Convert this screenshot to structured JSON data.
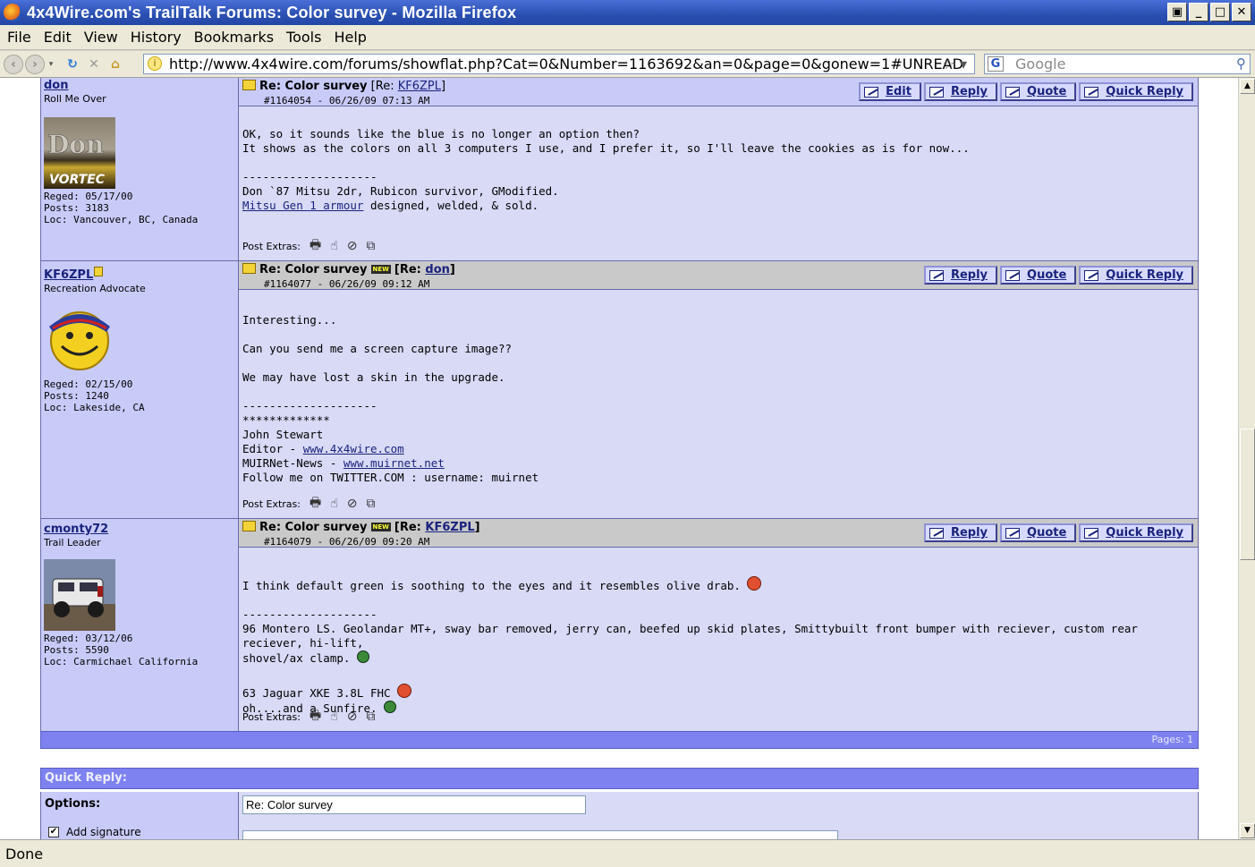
{
  "window": {
    "title": "4x4Wire.com's TrailTalk Forums: Color survey - Mozilla Firefox"
  },
  "menu": [
    "File",
    "Edit",
    "View",
    "History",
    "Bookmarks",
    "Tools",
    "Help"
  ],
  "toolbar": {
    "url": "http://www.4x4wire.com/forums/showflat.php?Cat=0&Number=1163692&an=0&page=0&gonew=1#UNREAD",
    "search_placeholder": "Google"
  },
  "status": "Done",
  "posts": [
    {
      "username": "don",
      "user_title": "Roll Me Over",
      "reged": "Reged: 05/17/00",
      "posts": "Posts: 3183",
      "loc": "Loc: Vancouver, BC, Canada",
      "subject": "Re: Color survey",
      "re_prefix": "[Re: ",
      "re_user": "KF6ZPL",
      "re_suffix": "]",
      "post_id": "#1164054 - 06/26/09 07:13 AM",
      "buttons": [
        "Edit",
        "Reply",
        "Quote",
        "Quick Reply"
      ],
      "body": [
        "OK, so it sounds like the blue is no longer an option then?",
        "It shows as the colors on all 3 computers I use, and I prefer it, so I'll leave the cookies as is for now...",
        "",
        "--------------------",
        "Don `87 Mitsu 2dr, Rubicon survivor, GModified."
      ],
      "link_text": "Mitsu Gen 1 armour",
      "link_suffix": " designed, welded, & sold.",
      "extras_label": "Post Extras:"
    },
    {
      "username": "KF6ZPL",
      "user_title": "Recreation Advocate",
      "reged": "Reged: 02/15/00",
      "posts": "Posts: 1240",
      "loc": "Loc: Lakeside, CA",
      "subject": "Re: Color survey",
      "new_tag": "NEW",
      "re_prefix": "[Re: ",
      "re_user": "don",
      "re_suffix": "]",
      "post_id": "#1164077 - 06/26/09 09:12 AM",
      "buttons": [
        "Reply",
        "Quote",
        "Quick Reply"
      ],
      "body": [
        "Interesting...",
        "",
        "Can you send me a screen capture image??",
        "",
        "We may have lost a skin in the upgrade.",
        "",
        "--------------------",
        "*************",
        "John Stewart"
      ],
      "editor_prefix": "Editor - ",
      "editor_link": "www.4x4wire.com",
      "muir_prefix": "MUIRNet-News - ",
      "muir_link": "www.muirnet.net",
      "follow": "Follow me on TWITTER.COM : username: muirnet",
      "extras_label": "Post Extras:"
    },
    {
      "username": "cmonty72",
      "user_title": "Trail Leader",
      "reged": "Reged: 03/12/06",
      "posts": "Posts: 5590",
      "loc": "Loc: Carmichael California",
      "subject": "Re: Color survey",
      "new_tag": "NEW",
      "re_prefix": "[Re: ",
      "re_user": "KF6ZPL",
      "re_suffix": "]",
      "post_id": "#1164079 - 06/26/09 09:20 AM",
      "buttons": [
        "Reply",
        "Quote",
        "Quick Reply"
      ],
      "body1": "I think default green is soothing to the eyes and it resembles olive drab.",
      "sep": "--------------------",
      "body2": "96 Montero LS. Geolandar MT+, sway bar removed, jerry can, beefed up skid plates, Smittybuilt front bumper with reciever, custom rear reciever, hi-lift,",
      "body3": "shovel/ax clamp.",
      "body4": "63 Jaguar XKE 3.8L FHC",
      "body5": "oh....and a Sunfire.",
      "extras_label": "Post Extras:"
    }
  ],
  "pages": "Pages: 1",
  "quick_reply": {
    "header": "Quick Reply:",
    "options_label": "Options:",
    "subject_value": "Re: Color survey",
    "add_signature": "Add signature"
  }
}
